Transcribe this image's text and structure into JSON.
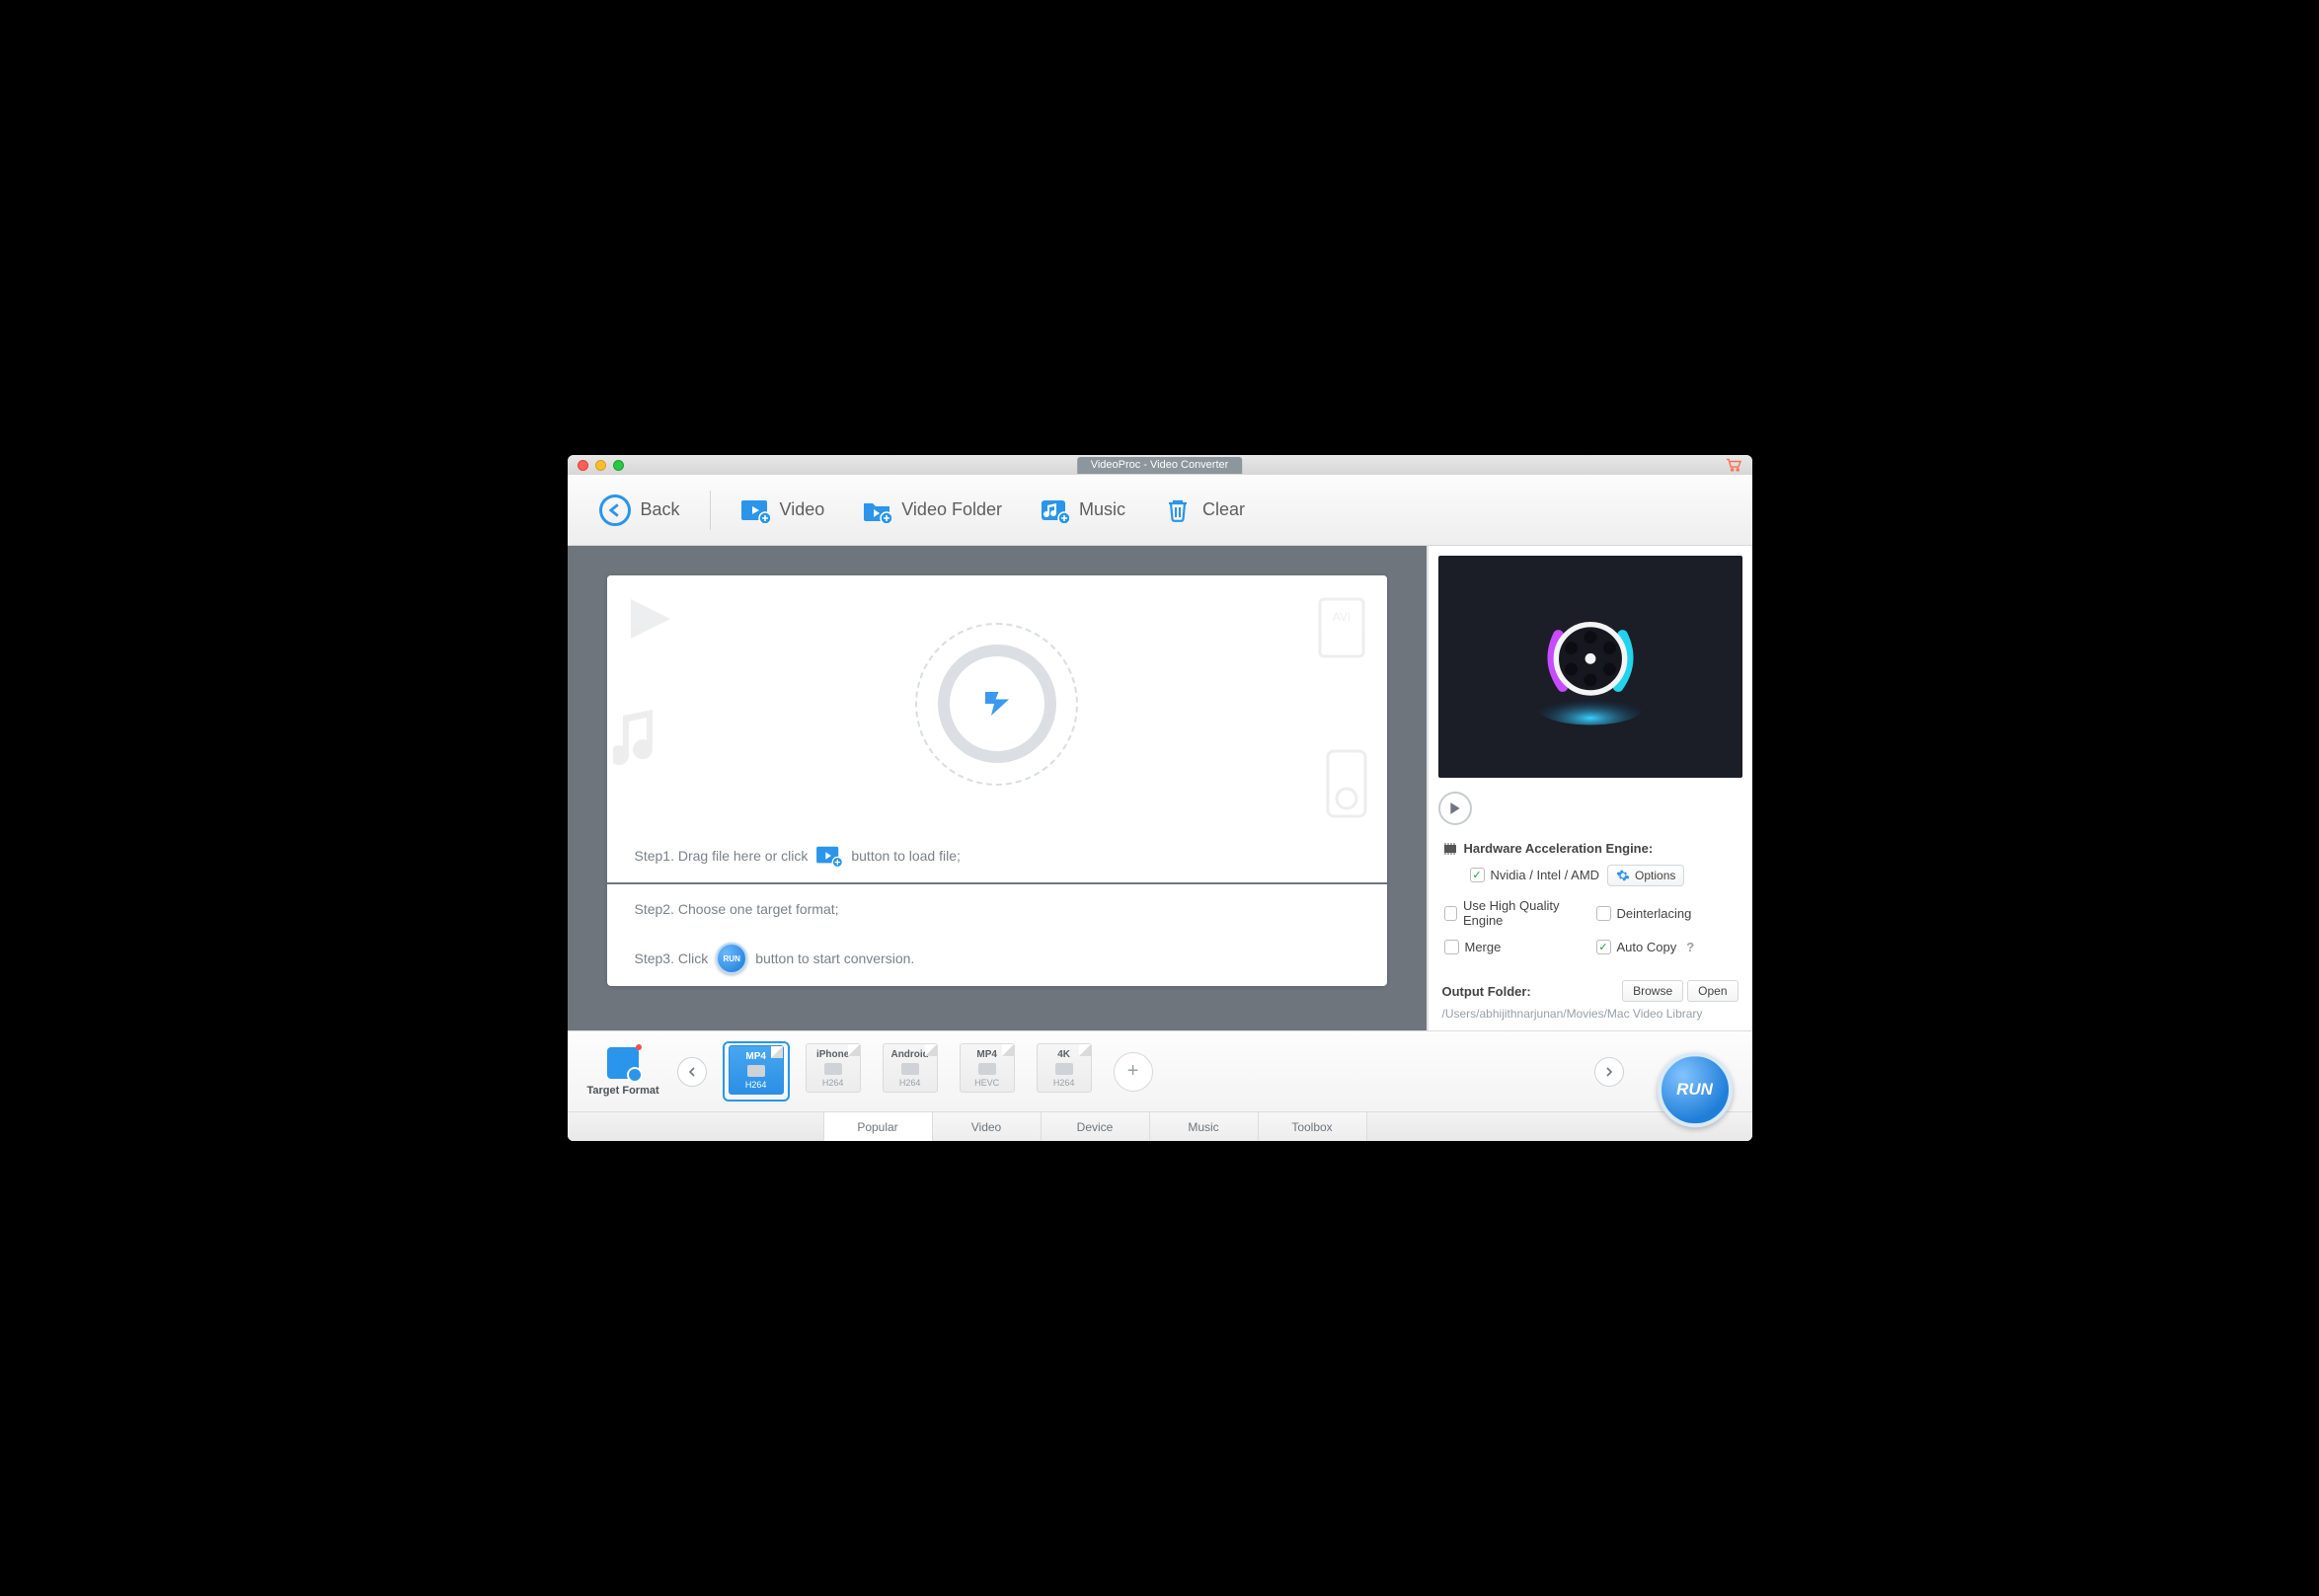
{
  "title": "VideoProc - Video Converter",
  "toolbar": {
    "back": "Back",
    "video": "Video",
    "video_folder": "Video Folder",
    "music": "Music",
    "clear": "Clear"
  },
  "drop": {
    "step1a": "Step1. Drag file here or click",
    "step1b": "button to load file;",
    "step2": "Step2. Choose one target format;",
    "step3a": "Step3. Click",
    "step3b": "button to start conversion.",
    "mini_run": "RUN"
  },
  "hwaccel": {
    "header": "Hardware Acceleration Engine:",
    "nvidia": "Nvidia / Intel / AMD",
    "options": "Options",
    "high_quality": "Use High Quality Engine",
    "deinterlacing": "Deinterlacing",
    "merge": "Merge",
    "auto_copy": "Auto Copy"
  },
  "output": {
    "label": "Output Folder:",
    "browse": "Browse",
    "open": "Open",
    "path": "/Users/abhijithnarjunan/Movies/Mac Video Library"
  },
  "target_format_label": "Target Format",
  "formats": [
    {
      "label": "MP4",
      "codec": "H264",
      "selected": true
    },
    {
      "label": "iPhone",
      "codec": "H264",
      "selected": false
    },
    {
      "label": "Android",
      "codec": "H264",
      "selected": false
    },
    {
      "label": "MP4",
      "codec": "HEVC",
      "selected": false
    },
    {
      "label": "4K",
      "codec": "H264",
      "selected": false
    }
  ],
  "tabs": [
    "Popular",
    "Video",
    "Device",
    "Music",
    "Toolbox"
  ],
  "active_tab": 0,
  "run_label": "RUN"
}
